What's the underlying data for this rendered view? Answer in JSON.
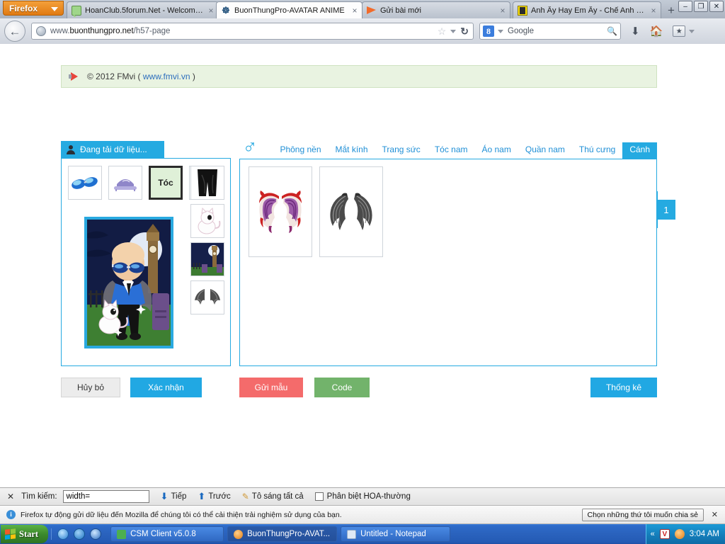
{
  "browser": {
    "firefox_button": "Firefox",
    "tabs": [
      {
        "title": "HoanClub.5forum.Net - Welcome...",
        "favicon": "comment-bubble-icon",
        "active": false,
        "close": "×"
      },
      {
        "title": "BuonThungPro-AVATAR ANIME",
        "favicon": "spiral-icon",
        "active": true,
        "close": "×"
      },
      {
        "title": "Gửi bài mới",
        "favicon": "orange-flag-icon",
        "active": false,
        "close": "×"
      },
      {
        "title": "Anh Ấy Hay Em Ấy - Chế Anh Kh...",
        "favicon": "video-thumb-icon",
        "active": false,
        "close": "×"
      }
    ],
    "new_tab_label": "+",
    "window_buttons": [
      "–",
      "❐",
      "✕"
    ],
    "url_prefix": "www.",
    "url_domain": "buonthungpro.net",
    "url_path": "/h57-page",
    "search_engine": "Google",
    "search_placeholder": "Google"
  },
  "page": {
    "banner": {
      "text": "© 2012 FMvi (",
      "link": "www.fmvi.vn",
      "text_end": ")"
    },
    "left_panel": {
      "tab_label": "Đang tải dữ liệu...",
      "top_thumbs": [
        {
          "name": "sunglasses-thumb",
          "selected": false,
          "label": ""
        },
        {
          "name": "hat-thumb",
          "selected": false,
          "label": ""
        },
        {
          "name": "hair-thumb",
          "selected": true,
          "label": "Tóc"
        },
        {
          "name": "shirt-thumb",
          "selected": false,
          "label": ""
        }
      ],
      "side_thumbs": [
        {
          "name": "pants-thumb"
        },
        {
          "name": "pet-cat-thumb"
        },
        {
          "name": "background-thumb"
        },
        {
          "name": "wings-thumb"
        }
      ]
    },
    "main_panel": {
      "gender_icon": "male-gender-icon",
      "nav_tabs": [
        {
          "label": "Phông nền",
          "active": false
        },
        {
          "label": "Mắt kính",
          "active": false
        },
        {
          "label": "Trang sức",
          "active": false
        },
        {
          "label": "Tóc nam",
          "active": false
        },
        {
          "label": "Áo nam",
          "active": false
        },
        {
          "label": "Quần nam",
          "active": false
        },
        {
          "label": "Thú cưng",
          "active": false
        },
        {
          "label": "Cánh",
          "active": true
        }
      ],
      "items": [
        {
          "name": "red-purple-dragon-wings"
        },
        {
          "name": "gray-feather-wings"
        }
      ],
      "page_number": "1"
    },
    "buttons": {
      "cancel": "Hủy bỏ",
      "confirm": "Xác nhận",
      "send_sample": "Gửi mẫu",
      "code": "Code",
      "stats": "Thống kê"
    },
    "colors": {
      "accent_blue": "#25aae1",
      "red": "#f46b6b",
      "green": "#72b36b",
      "banner_green": "#e9f3e1"
    }
  },
  "findbar": {
    "close": "✕",
    "label": "Tìm kiếm:",
    "value": "width=",
    "placeholder": "",
    "next": "Tiếp",
    "previous": "Trước",
    "highlight_all": "Tô sáng tất cả",
    "match_case": "Phân biệt HOA-thường"
  },
  "notification": {
    "icon": "info-icon",
    "message": "Firefox tự động gửi dữ liệu đến Mozilla để chúng tôi có thể cải thiện trải nghiệm sử dụng của bạn.",
    "button": "Chọn những thứ tôi muốn chia sẻ",
    "close": "✕"
  },
  "taskbar": {
    "start": "Start",
    "quick_launch": [
      "internet-explorer-icon",
      "blue-app-icon",
      "media-player-icon"
    ],
    "items": [
      {
        "label": "CSM Client v5.0.8",
        "icon": "csm-icon",
        "active": false
      },
      {
        "label": "BuonThungPro-AVAT...",
        "icon": "firefox-icon",
        "active": true
      },
      {
        "label": "Untitled - Notepad",
        "icon": "notepad-icon",
        "active": false
      }
    ],
    "tray": {
      "chevron": "«",
      "icons": [
        "antivirus-v-icon",
        "spiral-app-icon"
      ],
      "clock": "3:04 AM"
    }
  }
}
